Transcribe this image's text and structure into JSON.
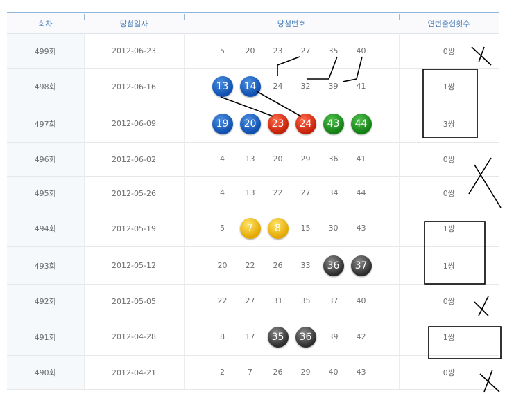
{
  "headers": [
    "회차",
    "당첨일자",
    "당첨번호",
    "연번출현횟수"
  ],
  "rows": [
    {
      "round": "499회",
      "date": "2012-06-23",
      "count": "0쌍",
      "nums": [
        {
          "n": "5"
        },
        {
          "n": "20"
        },
        {
          "n": "23"
        },
        {
          "n": "27"
        },
        {
          "n": "35"
        },
        {
          "n": "40"
        }
      ]
    },
    {
      "round": "498회",
      "date": "2012-06-16",
      "count": "1쌍",
      "nums": [
        {
          "n": "13",
          "ball": "blue"
        },
        {
          "n": "14",
          "ball": "blue"
        },
        {
          "n": "24"
        },
        {
          "n": "32"
        },
        {
          "n": "39"
        },
        {
          "n": "41"
        }
      ]
    },
    {
      "round": "497회",
      "date": "2012-06-09",
      "count": "3쌍",
      "nums": [
        {
          "n": "19",
          "ball": "blue"
        },
        {
          "n": "20",
          "ball": "blue"
        },
        {
          "n": "23",
          "ball": "red"
        },
        {
          "n": "24",
          "ball": "red"
        },
        {
          "n": "43",
          "ball": "green"
        },
        {
          "n": "44",
          "ball": "green"
        }
      ]
    },
    {
      "round": "496회",
      "date": "2012-06-02",
      "count": "0쌍",
      "nums": [
        {
          "n": "4"
        },
        {
          "n": "13"
        },
        {
          "n": "20"
        },
        {
          "n": "29"
        },
        {
          "n": "36"
        },
        {
          "n": "41"
        }
      ]
    },
    {
      "round": "495회",
      "date": "2012-05-26",
      "count": "0쌍",
      "nums": [
        {
          "n": "4"
        },
        {
          "n": "13"
        },
        {
          "n": "22"
        },
        {
          "n": "27"
        },
        {
          "n": "34"
        },
        {
          "n": "44"
        }
      ]
    },
    {
      "round": "494회",
      "date": "2012-05-19",
      "count": "1쌍",
      "nums": [
        {
          "n": "5"
        },
        {
          "n": "7",
          "ball": "yellow"
        },
        {
          "n": "8",
          "ball": "yellow"
        },
        {
          "n": "15"
        },
        {
          "n": "30"
        },
        {
          "n": "43"
        }
      ]
    },
    {
      "round": "493회",
      "date": "2012-05-12",
      "count": "1쌍",
      "nums": [
        {
          "n": "20"
        },
        {
          "n": "22"
        },
        {
          "n": "26"
        },
        {
          "n": "33"
        },
        {
          "n": "36",
          "ball": "gray"
        },
        {
          "n": "37",
          "ball": "gray"
        }
      ]
    },
    {
      "round": "492회",
      "date": "2012-05-05",
      "count": "0쌍",
      "nums": [
        {
          "n": "22"
        },
        {
          "n": "27"
        },
        {
          "n": "31"
        },
        {
          "n": "35"
        },
        {
          "n": "37"
        },
        {
          "n": "40"
        }
      ]
    },
    {
      "round": "491회",
      "date": "2012-04-28",
      "count": "1쌍",
      "nums": [
        {
          "n": "8"
        },
        {
          "n": "17"
        },
        {
          "n": "35",
          "ball": "gray"
        },
        {
          "n": "36",
          "ball": "gray"
        },
        {
          "n": "39"
        },
        {
          "n": "42"
        }
      ]
    },
    {
      "round": "490회",
      "date": "2012-04-21",
      "count": "0쌍",
      "nums": [
        {
          "n": "2"
        },
        {
          "n": "7"
        },
        {
          "n": "26"
        },
        {
          "n": "29"
        },
        {
          "n": "40"
        },
        {
          "n": "43"
        }
      ]
    }
  ],
  "colors": {
    "blue": "#1560c0",
    "red": "#d8260a",
    "green": "#1a921a",
    "yellow": "#f2c21a",
    "gray": "#444444",
    "header_text": "#4a7fb8"
  }
}
